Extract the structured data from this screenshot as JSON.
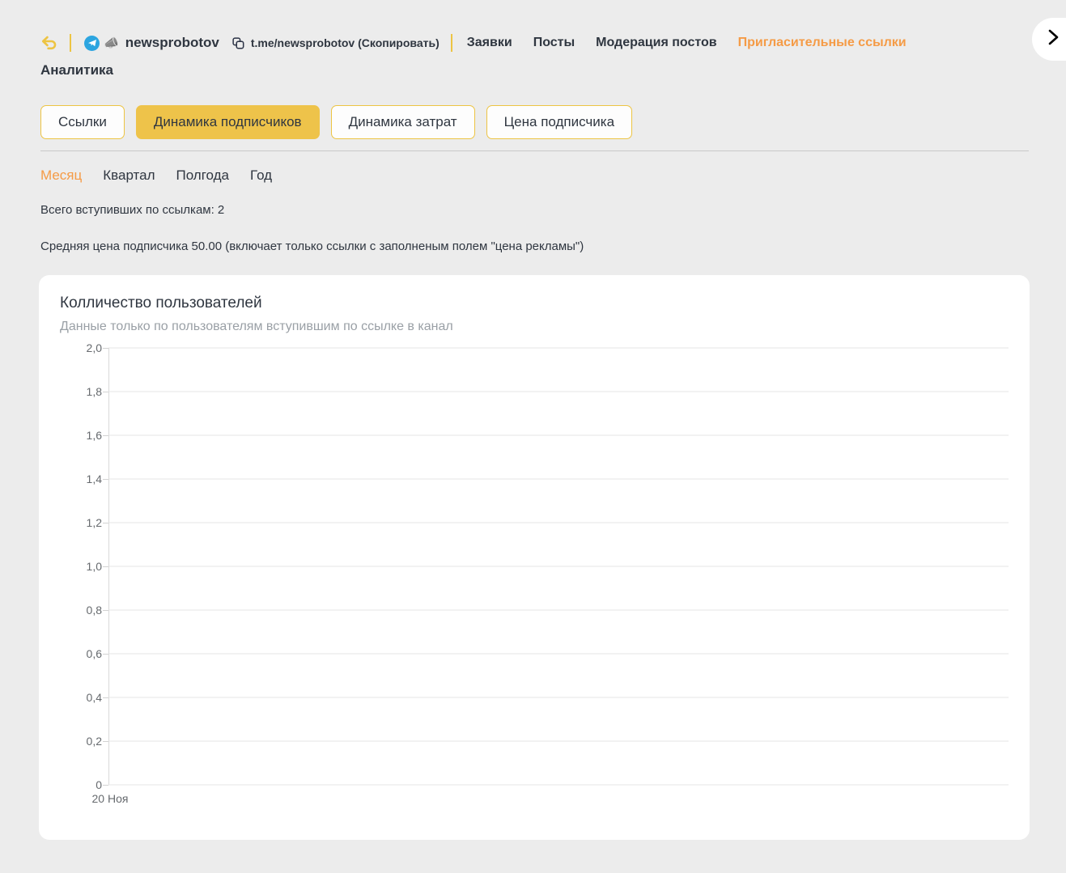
{
  "topbar": {
    "back_icon": "back-arrow-icon",
    "telegram_icon": "telegram-icon",
    "megaphone_icon": "megaphone-icon",
    "channel_name": "newsprobotov",
    "copy_icon": "copy-icon",
    "tme_link": "t.me/newsprobotov (Скопировать)",
    "nav_items": [
      {
        "label": "Заявки",
        "active": false
      },
      {
        "label": "Посты",
        "active": false
      },
      {
        "label": "Модерация постов",
        "active": false
      },
      {
        "label": "Пригласительные ссылки",
        "active": true
      }
    ],
    "page_title": "Аналитика",
    "side_toggle_icon": "chevron-right-icon",
    "accent_color": "#f59b46",
    "gold_color": "#edc443"
  },
  "tabs": [
    {
      "label": "Ссылки",
      "active": false
    },
    {
      "label": "Динамика подписчиков",
      "active": true
    },
    {
      "label": "Динамика затрат",
      "active": false
    },
    {
      "label": "Цена подписчика",
      "active": false
    }
  ],
  "periods": [
    {
      "label": "Месяц",
      "active": true
    },
    {
      "label": "Квартал",
      "active": false
    },
    {
      "label": "Полгода",
      "active": false
    },
    {
      "label": "Год",
      "active": false
    }
  ],
  "summary": {
    "total_joined": "Всего вступивших по ссылкам: 2",
    "avg_price": "Средняя цена подписчика 50.00 (включает только ссылки с заполненым полем \"цена рекламы\")"
  },
  "card": {
    "title": "Колличество пользователей",
    "subtitle": "Данные только по пользователям вступившим по ссылке в канал"
  },
  "chart_data": {
    "type": "line",
    "title": "Колличество пользователей",
    "subtitle": "Данные только по пользователям вступившим по ссылке в канал",
    "xlabel": "",
    "ylabel": "",
    "x": [
      "20 Ноя"
    ],
    "categories": [
      "20 Ноя"
    ],
    "values": [
      0
    ],
    "series": [
      {
        "name": "Колличество пользователей",
        "values": [
          0
        ]
      }
    ],
    "ylim": [
      0,
      2
    ],
    "yticks": [
      0,
      0.2,
      0.4,
      0.6,
      0.8,
      1.0,
      1.2,
      1.4,
      1.6,
      1.8,
      2.0
    ],
    "ytick_labels": [
      "0",
      "0,2",
      "0,4",
      "0,6",
      "0,8",
      "1,0",
      "1,2",
      "1,4",
      "1,6",
      "1,8",
      "2,0"
    ],
    "xtick_labels": [
      "20 Ноя"
    ],
    "grid": true,
    "legend": false,
    "note": "no data points plotted - empty series"
  }
}
